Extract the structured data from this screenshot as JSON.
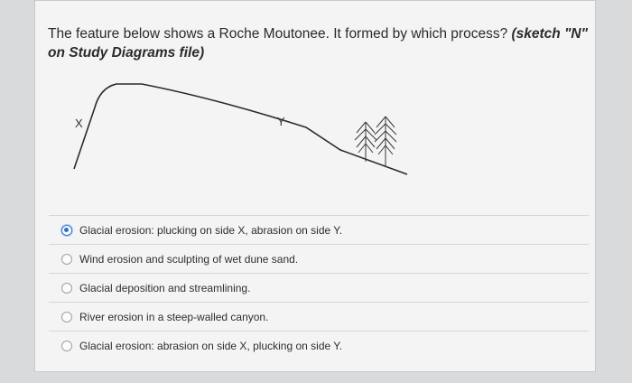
{
  "question": {
    "text": "The feature below shows a Roche Moutonee. It formed by which process?",
    "hint": "(sketch \"N\" on Study Diagrams file)"
  },
  "figure": {
    "label_x": "X",
    "label_y": "Y",
    "icon": "trees-icon"
  },
  "options": [
    {
      "label": "Glacial erosion: plucking on side X, abrasion on side Y.",
      "selected": true
    },
    {
      "label": "Wind erosion and sculpting of wet dune sand.",
      "selected": false
    },
    {
      "label": "Glacial deposition and streamlining.",
      "selected": false
    },
    {
      "label": "River erosion in a steep-walled canyon.",
      "selected": false
    },
    {
      "label": "Glacial erosion: abrasion on side X, plucking on side Y.",
      "selected": false
    }
  ],
  "colors": {
    "selected_radio": "#2f6fcf",
    "card_background": "#f4f4f5"
  }
}
